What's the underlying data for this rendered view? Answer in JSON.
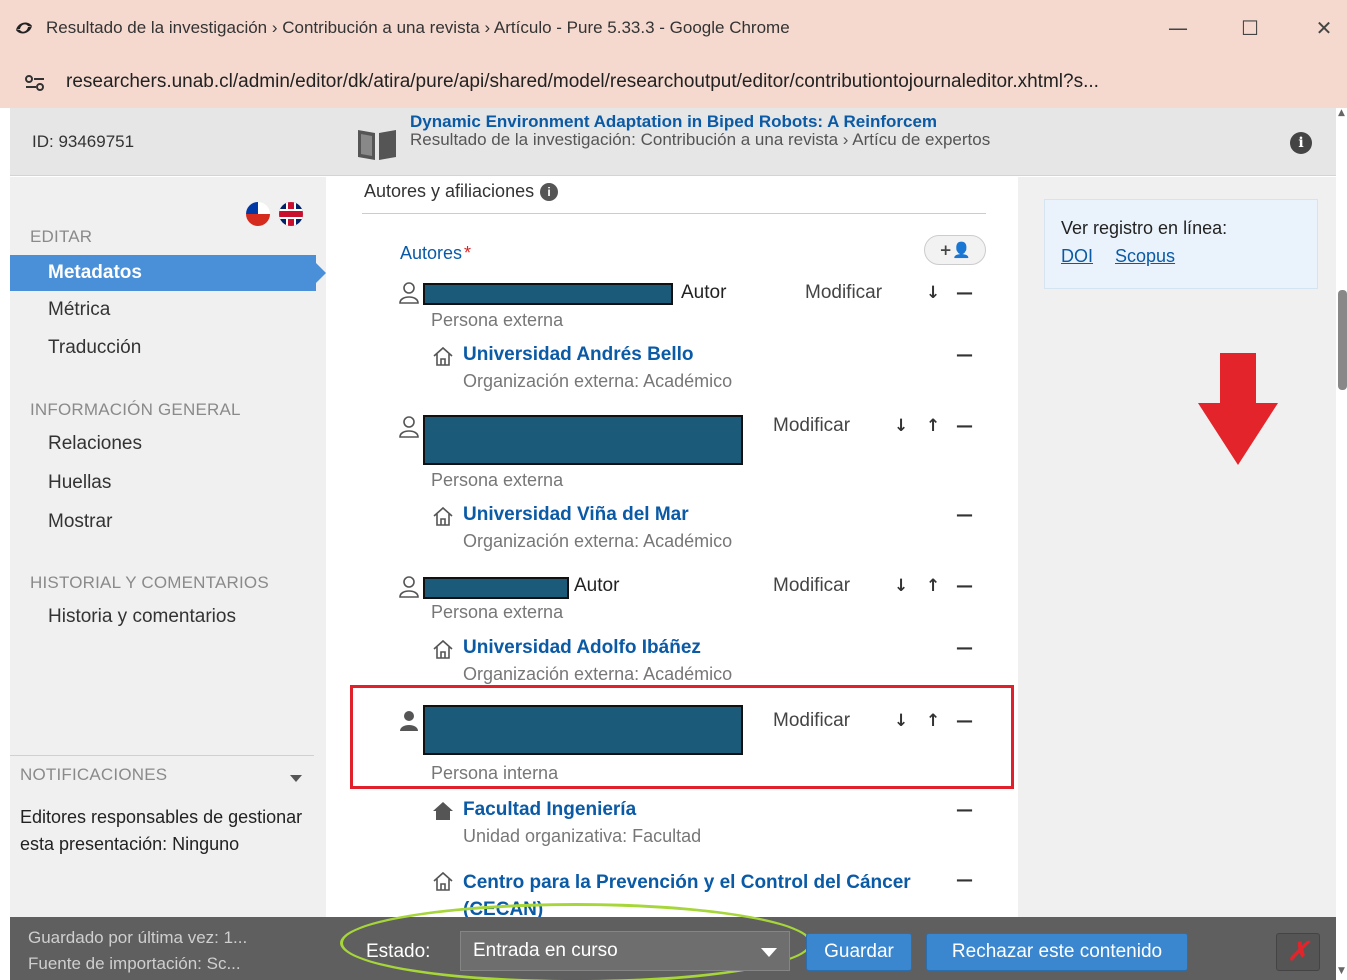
{
  "window": {
    "title": "Resultado de la investigación › Contribución a una revista › Artículo - Pure 5.33.3 - Google Chrome",
    "minimize": "—",
    "maximize": "☐",
    "close": "✕"
  },
  "address": {
    "url": "researchers.unab.cl/admin/editor/dk/atira/pure/api/shared/model/researchoutput/editor/contributiontojournaleditor.xhtml?s..."
  },
  "header": {
    "id": "ID: 93469751",
    "title": "Dynamic Environment Adaptation in Biped Robots: A Reinforcem",
    "subtitle": "Resultado de la investigación: Contribución a una revista › Artícu de expertos",
    "info_icon": "i"
  },
  "sidebar": {
    "edit_head": "EDITAR",
    "edit_items": [
      "Metadatos",
      "Métrica",
      "Traducción"
    ],
    "general_head": "INFORMACIÓN GENERAL",
    "general_items": [
      "Relaciones",
      "Huellas",
      "Mostrar"
    ],
    "history_head": "HISTORIAL Y COMENTARIOS",
    "history_items": [
      "Historia y comentarios"
    ],
    "notif_head": "NOTIFICACIONES",
    "notif_text": "Editores responsables de gestionar esta presentación: Ninguno"
  },
  "main": {
    "section_title": "Autores y afiliaciones",
    "section_info": "i",
    "authors_label": "Autores",
    "required_mark": "*",
    "add_author": "+👤",
    "modify_label": "Modificar",
    "down": "↓",
    "up": "↑",
    "remove": "—",
    "authors": [
      {
        "role": "Autor",
        "type": "Persona externa",
        "org": "Universidad Andrés Bello",
        "org_type": "Organización externa: Académico"
      },
      {
        "role": "",
        "type": "Persona externa",
        "org": "Universidad Viña del Mar",
        "org_type": "Organización externa: Académico"
      },
      {
        "role": "Autor",
        "type": "Persona externa",
        "org": "Universidad Adolfo Ibáñez",
        "org_type": "Organización externa: Académico"
      },
      {
        "role": "",
        "type": "Persona interna",
        "org": "Facultad Ingeniería",
        "org_type": "Unidad organizativa: Facultad",
        "org2": "Centro para la Prevención y el Control del Cáncer (CECAN)"
      }
    ]
  },
  "right": {
    "online_label": "Ver registro en línea:",
    "doi": "DOI",
    "scopus": "Scopus"
  },
  "bottom": {
    "saved_line1": "Guardado por última vez: 1...",
    "saved_line2": "Fuente de importación: Sc...",
    "estado_label": "Estado:",
    "estado_value": "Entrada en curso",
    "save": "Guardar",
    "reject": "Rechazar este contenido",
    "close": "✗"
  },
  "colors": {
    "accent": "#4a90d9",
    "link": "#0a5aa6",
    "highlight_red": "#e0202a",
    "highlight_green": "#a6d63a",
    "redaction": "#1c5a7a"
  }
}
